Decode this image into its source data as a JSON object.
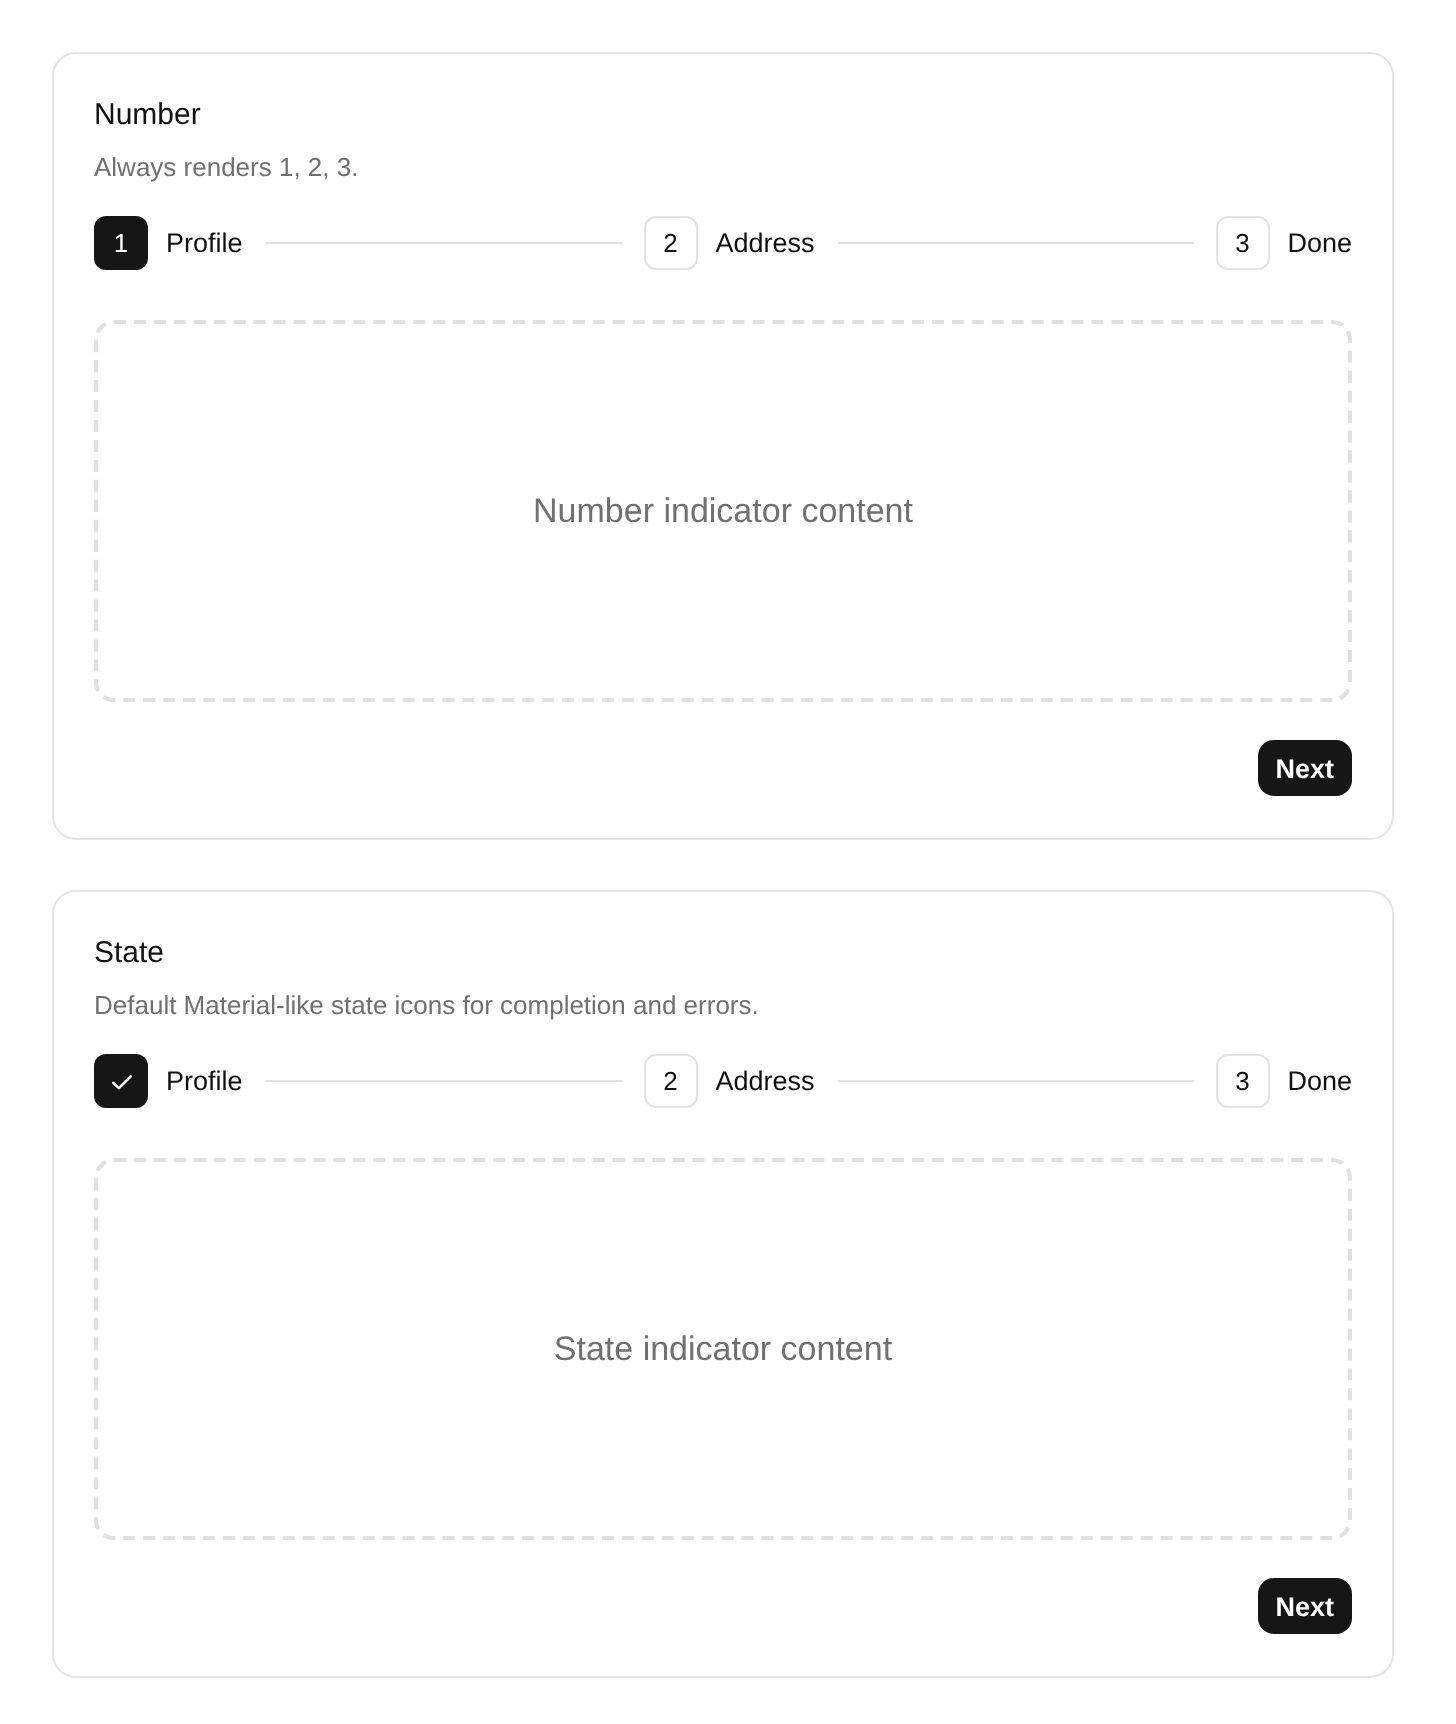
{
  "cards": [
    {
      "title": "Number",
      "description": "Always renders 1, 2, 3.",
      "steps": [
        {
          "number": "1",
          "label": "Profile",
          "active": true,
          "completed": false
        },
        {
          "number": "2",
          "label": "Address",
          "active": false,
          "completed": false
        },
        {
          "number": "3",
          "label": "Done",
          "active": false,
          "completed": false
        }
      ],
      "content": "Number indicator content",
      "button": "Next"
    },
    {
      "title": "State",
      "description": "Default Material-like state icons for completion and errors.",
      "steps": [
        {
          "label": "Profile",
          "active": true,
          "completed": true
        },
        {
          "number": "2",
          "label": "Address",
          "active": false,
          "completed": false
        },
        {
          "number": "3",
          "label": "Done",
          "active": false,
          "completed": false
        }
      ],
      "content": "State indicator content",
      "button": "Next"
    }
  ]
}
